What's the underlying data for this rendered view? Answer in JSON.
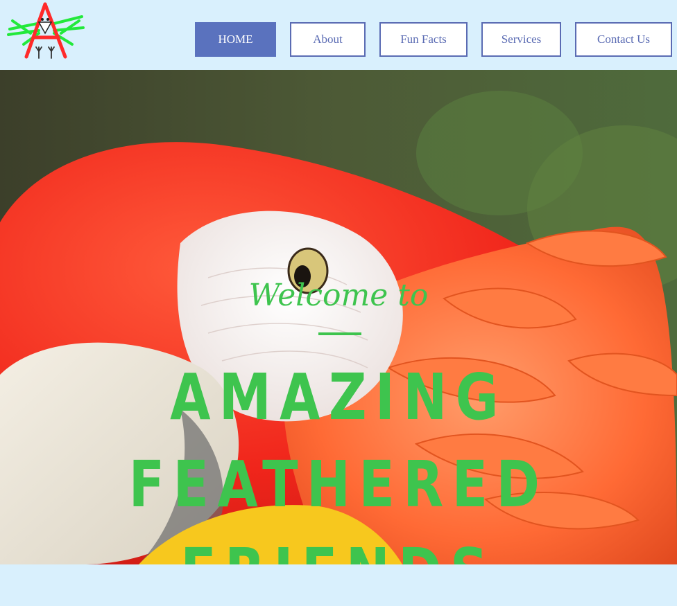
{
  "nav": {
    "items": [
      {
        "label": "HOME",
        "active": true
      },
      {
        "label": "About",
        "active": false
      },
      {
        "label": "Fun Facts",
        "active": false
      },
      {
        "label": "Services",
        "active": false
      },
      {
        "label": "Contact Us",
        "active": false
      }
    ]
  },
  "hero": {
    "welcome": "Welcome to",
    "headline": "AMAZING FEATHERED FRIENDS"
  },
  "colors": {
    "background": "#d9f0fd",
    "nav_accent": "#5a72be",
    "headline_green": "#3ec44e",
    "logo_red": "#ff2a2a",
    "logo_green": "#22e93b"
  },
  "icons": {
    "logo": "bird-logo-icon"
  }
}
